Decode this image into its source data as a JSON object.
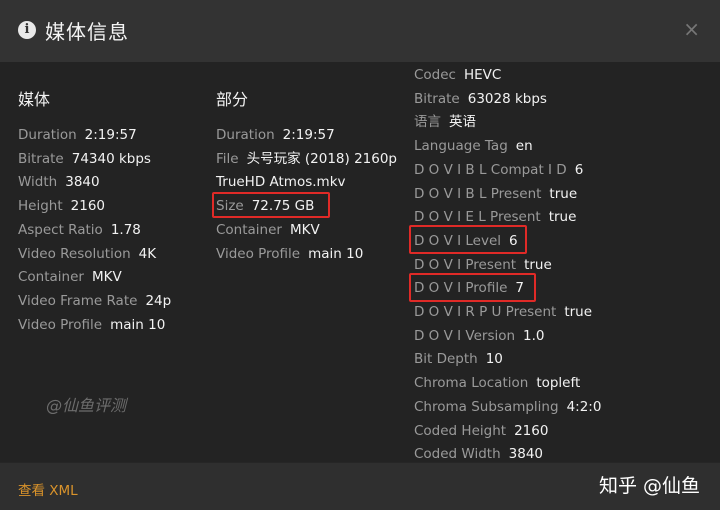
{
  "dialog": {
    "title": "媒体信息",
    "close_label": "×",
    "info_icon": "i"
  },
  "media": {
    "heading": "媒体",
    "rows": [
      {
        "label": "Duration",
        "value": "2:19:57"
      },
      {
        "label": "Bitrate",
        "value": "74340 kbps"
      },
      {
        "label": "Width",
        "value": "3840"
      },
      {
        "label": "Height",
        "value": "2160"
      },
      {
        "label": "Aspect Ratio",
        "value": "1.78"
      },
      {
        "label": "Video Resolution",
        "value": "4K"
      },
      {
        "label": "Container",
        "value": "MKV"
      },
      {
        "label": "Video Frame Rate",
        "value": "24p"
      },
      {
        "label": "Video Profile",
        "value": "main 10"
      }
    ]
  },
  "part": {
    "heading": "部分",
    "duration": {
      "label": "Duration",
      "value": "2:19:57"
    },
    "file": {
      "label": "File",
      "value_line1": "头号玩家 (2018) 2160p",
      "value_line2": "TrueHD Atmos.mkv"
    },
    "size": {
      "label": "Size",
      "value": "72.75 GB"
    },
    "container": {
      "label": "Container",
      "value": "MKV"
    },
    "video_profile": {
      "label": "Video Profile",
      "value": "main 10"
    }
  },
  "stream": {
    "rows": [
      {
        "label": "Codec",
        "value": "HEVC"
      },
      {
        "label": "Bitrate",
        "value": "63028 kbps"
      },
      {
        "label": "语言",
        "value": "英语"
      },
      {
        "label": "Language Tag",
        "value": "en"
      },
      {
        "label": "D O V I B L Compat I D",
        "value": "6"
      },
      {
        "label": "D O V I B L Present",
        "value": "true"
      },
      {
        "label": "D O V I E L Present",
        "value": "true"
      },
      {
        "label": "D O V I Level",
        "value": "6"
      },
      {
        "label": "D O V I Present",
        "value": "true"
      },
      {
        "label": "D O V I Profile",
        "value": "7"
      },
      {
        "label": "D O V I R P U Present",
        "value": "true"
      },
      {
        "label": "D O V I Version",
        "value": "1.0"
      },
      {
        "label": "Bit Depth",
        "value": "10"
      },
      {
        "label": "Chroma Location",
        "value": "topleft"
      },
      {
        "label": "Chroma Subsampling",
        "value": "4:2:0"
      },
      {
        "label": "Coded Height",
        "value": "2160"
      },
      {
        "label": "Coded Width",
        "value": "3840"
      }
    ]
  },
  "watermark": "@仙鱼评测",
  "footer": {
    "xml_link": "查看 XML",
    "zhihu_watermark": "知乎 @仙鱼"
  },
  "colors": {
    "accent": "#d9932b",
    "highlight": "#e02a27",
    "background": "#232323"
  },
  "icons": {
    "info": "info-icon",
    "close": "close-icon"
  }
}
